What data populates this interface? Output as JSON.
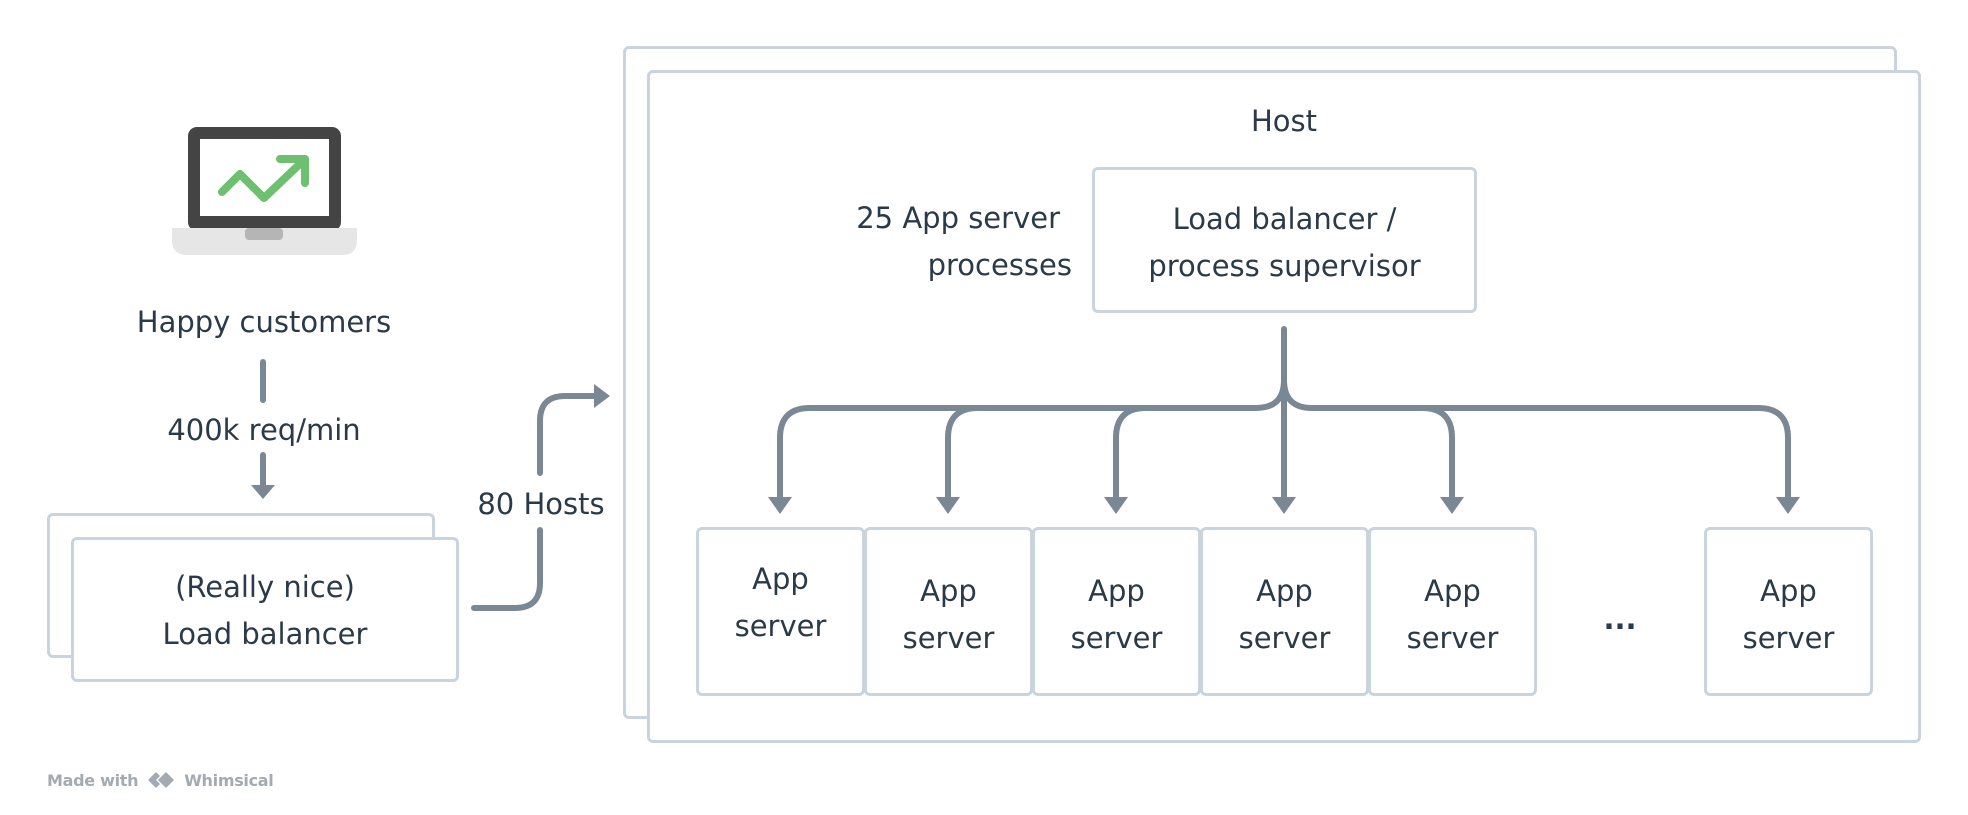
{
  "customer": {
    "icon": "laptop-trending-up-icon",
    "label": "Happy customers",
    "rate": "400k req/min"
  },
  "load_balancer": {
    "line1": "(Really nice)",
    "line2": "Load balancer"
  },
  "hosts_edge_label": "80 Hosts",
  "host": {
    "title": "Host",
    "note_line1": "25 App server",
    "note_line2": "processes",
    "supervisor_line1": "Load balancer /",
    "supervisor_line2": "process supervisor",
    "app_servers": [
      {
        "line1": "App",
        "line2": "server"
      },
      {
        "line1": "App",
        "line2": "server"
      },
      {
        "line1": "App",
        "line2": "server"
      },
      {
        "line1": "App",
        "line2": "server"
      },
      {
        "line1": "App",
        "line2": "server"
      },
      {
        "line1": "App",
        "line2": "server"
      }
    ],
    "ellipsis": "..."
  },
  "colors": {
    "box_border": "#c9d4de",
    "arrow": "#7a8896",
    "text": "#2b3a48",
    "laptop_frame": "#444444",
    "laptop_base": "#e6e6e6",
    "trend_arrow": "#6cc070"
  },
  "footer": {
    "made_with": "Made with",
    "brand": "Whimsical"
  }
}
